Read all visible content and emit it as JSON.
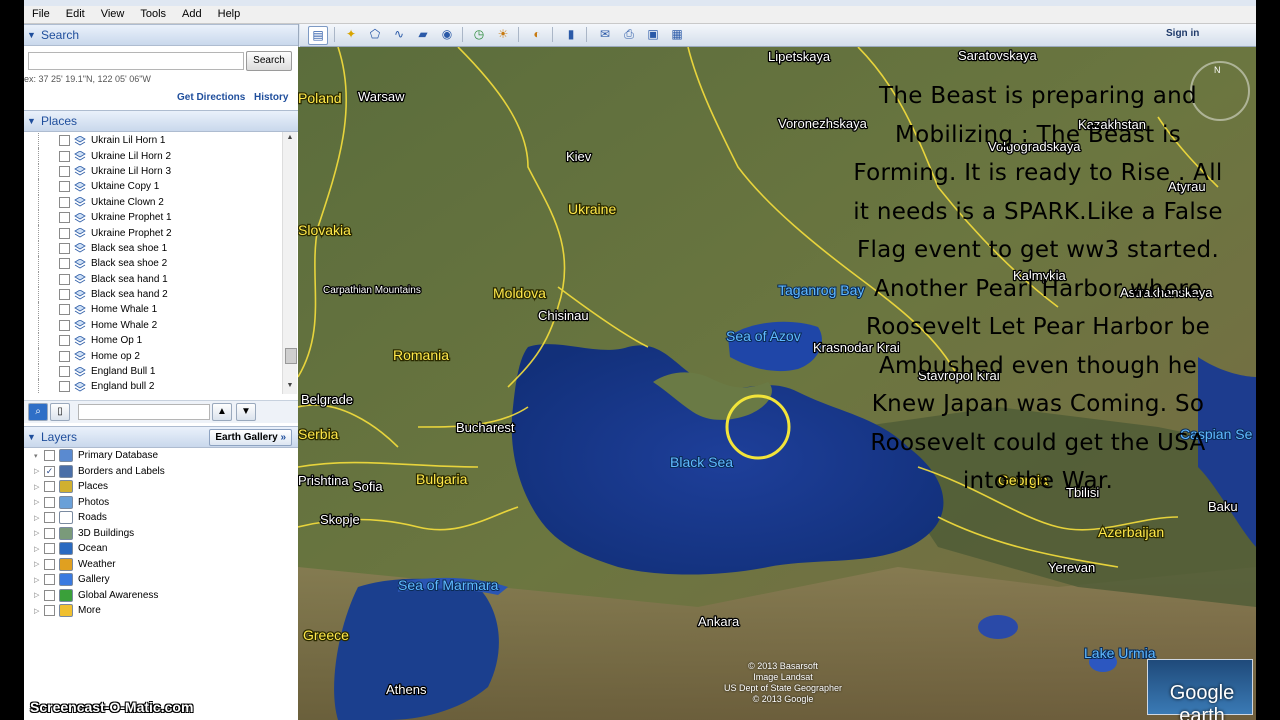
{
  "menubar": [
    "File",
    "Edit",
    "View",
    "Tools",
    "Add",
    "Help"
  ],
  "search": {
    "header": "Search",
    "button": "Search",
    "coords": "ex: 37 25' 19.1\"N, 122 05' 06\"W",
    "get_directions": "Get Directions",
    "history": "History"
  },
  "places": {
    "header": "Places",
    "items": [
      "Ukrain Lil Horn 1",
      "Ukraine Lil Horn 2",
      "Ukraine Lil Horn 3",
      "Uktaine Copy 1",
      "Uktaine Clown 2",
      "Ukraine Prophet 1",
      "Ukraine Prophet 2",
      "Black sea shoe 1",
      "Black sea shoe 2",
      "Black sea hand 1",
      "Black sea hand 2",
      "Home Whale 1",
      "Home Whale 2",
      "Home Op 1",
      "Home op 2",
      "England Bull 1",
      "England bull 2"
    ]
  },
  "layers": {
    "header": "Layers",
    "earth_gallery": "Earth Gallery",
    "earth_gallery_arrow": "»",
    "items": [
      {
        "label": "Primary Database",
        "icon": "globe-icon",
        "color": "#5a8ad0"
      },
      {
        "label": "Borders and Labels",
        "icon": "flag-icon",
        "color": "#4a6fa8",
        "checked": true
      },
      {
        "label": "Places",
        "icon": "places-icon",
        "color": "#d0b030"
      },
      {
        "label": "Photos",
        "icon": "photo-icon",
        "color": "#6aa0d8"
      },
      {
        "label": "Roads",
        "icon": "road-icon",
        "color": "#ffffff"
      },
      {
        "label": "3D Buildings",
        "icon": "building-icon",
        "color": "#7a9a7a"
      },
      {
        "label": "Ocean",
        "icon": "ocean-icon",
        "color": "#2a6ac0"
      },
      {
        "label": "Weather",
        "icon": "weather-icon",
        "color": "#e0a020"
      },
      {
        "label": "Gallery",
        "icon": "gallery-icon",
        "color": "#3a7ae0"
      },
      {
        "label": "Global Awareness",
        "icon": "awareness-icon",
        "color": "#3aa03a"
      },
      {
        "label": "More",
        "icon": "more-icon",
        "color": "#f0c030"
      }
    ]
  },
  "toolbar": {
    "sign_in": "Sign in"
  },
  "map": {
    "cities": [
      "Lipetskaya",
      "Saratovskaya",
      "Warsaw",
      "Voronezhskaya",
      "Volgogradskaya",
      "Kiev",
      "Atyrau",
      "Ukraine",
      "Kalmykia",
      "Astrakhanskaya",
      "Carpathian Mountains",
      "Moldova",
      "Chisinau",
      "Taganrog Bay",
      "Sea of Azov",
      "Krasnodar Krai",
      "Romania",
      "Stavropol Krai",
      "Belgrade",
      "Bucharest",
      "Black Sea",
      "Bulgaria",
      "Sofia",
      "Tbilisi",
      "Georgia",
      "Skopje",
      "Baku",
      "Azerbaijan",
      "Yerevan",
      "Sea of Marmara",
      "Greece",
      "Ankara",
      "Athens",
      "Lake Urmia",
      "Caspian Se",
      "Poland",
      "Kazakhstan",
      "Slovakia",
      "Serbia",
      "Prishtina"
    ],
    "overlay_text": "The Beast is preparing and Mobilizing : The Beast is Forming. It is ready to Rise . All it needs is a SPARK.Like a False Flag event to get ww3 started. Another Pearl Harbor where Roosevelt Let Pear Harbor be Ambushed even though he Knew Japan was Coming. So Roosevelt could get the USA into the War.",
    "copyright": [
      "© 2013 Basarsoft",
      "Image Landsat",
      "US Dept of State Geographer",
      "© 2013 Google"
    ],
    "logo": "Google earth",
    "compass_n": "N"
  },
  "watermark": "Screencast-O-Matic.com"
}
